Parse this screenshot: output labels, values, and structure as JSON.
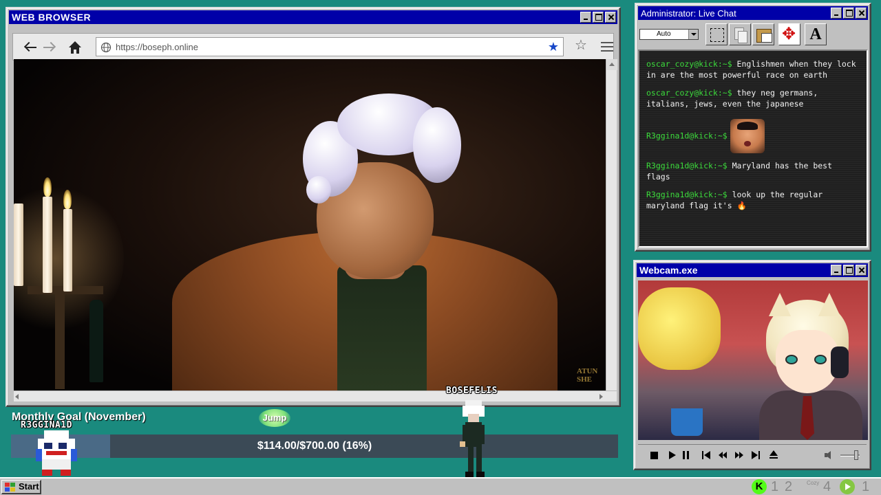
{
  "browser": {
    "title": "WEB BROWSER",
    "url": "https://boseph.online",
    "video_watermark": "ATUN\nSHE"
  },
  "chat": {
    "title": "Administrator: Live Chat",
    "font_size_select": "Auto",
    "messages": [
      {
        "user": "oscar_cozy@kick:~$",
        "text": " Englishmen when they lock in are the most powerful race on earth"
      },
      {
        "user": "oscar_cozy@kick:~$",
        "text": " they neg germans, italians, jews, even the japanese"
      },
      {
        "user": "R3ggina1d@kick:~$",
        "text": "",
        "emote": "shocked-face-emote"
      },
      {
        "user": "R3ggina1d@kick:~$",
        "text": " Maryland has the best flags"
      },
      {
        "user": "R3ggina1d@kick:~$",
        "text": " look up the regular maryland flag it's 🔥"
      }
    ]
  },
  "webcam": {
    "title": "Webcam.exe"
  },
  "goal": {
    "label": "Monthly Goal (November)",
    "amount_text": "$114.00/$700.00 (16%)",
    "current": 114.0,
    "target": 700.0,
    "percent": 16
  },
  "overlay": {
    "player1_name": "R3GGINA1D",
    "player2_name": "BOSEFELIS",
    "jump_label": "Jump"
  },
  "taskbar": {
    "start_label": "Start",
    "tray_nums": [
      "1",
      "2",
      "4",
      "1"
    ],
    "tray_cozy": "Cozy"
  },
  "colors": {
    "desktop": "#1a8a7e",
    "titlebar": "#0000a8",
    "chat_user": "#3cdc3c",
    "kick_green": "#53fc18"
  }
}
